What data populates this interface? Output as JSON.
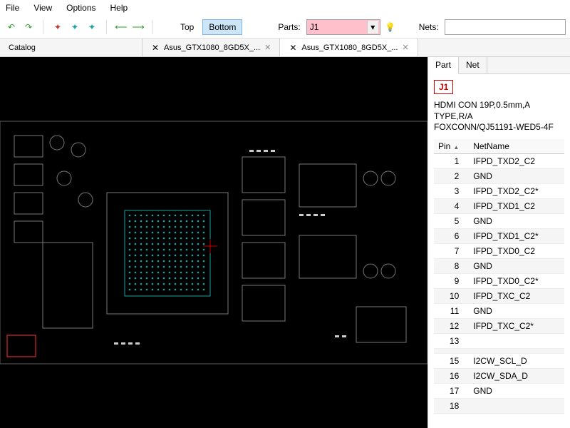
{
  "menu": {
    "file": "File",
    "view": "View",
    "options": "Options",
    "help": "Help"
  },
  "toolbar": {
    "top_label": "Top",
    "bottom_label": "Bottom",
    "parts_label": "Parts:",
    "nets_label": "Nets:",
    "parts_value": "J1",
    "nets_value": ""
  },
  "tabs": {
    "catalog": "Catalog",
    "items": [
      {
        "label": "Asus_GTX1080_8GD5X_..."
      },
      {
        "label": "Asus_GTX1080_8GD5X_..."
      }
    ]
  },
  "side": {
    "tab_part": "Part",
    "tab_net": "Net",
    "part_name": "J1",
    "desc_line1": "HDMI CON 19P,0.5mm,A TYPE,R/A",
    "desc_line2": "FOXCONN/QJ51191-WED5-4F",
    "col_pin": "Pin",
    "col_net": "NetName",
    "pins": [
      {
        "pin": "1",
        "net": "IFPD_TXD2_C2"
      },
      {
        "pin": "2",
        "net": "GND"
      },
      {
        "pin": "3",
        "net": "IFPD_TXD2_C2*"
      },
      {
        "pin": "4",
        "net": "IFPD_TXD1_C2"
      },
      {
        "pin": "5",
        "net": "GND"
      },
      {
        "pin": "6",
        "net": "IFPD_TXD1_C2*"
      },
      {
        "pin": "7",
        "net": "IFPD_TXD0_C2"
      },
      {
        "pin": "8",
        "net": "GND"
      },
      {
        "pin": "9",
        "net": "IFPD_TXD0_C2*"
      },
      {
        "pin": "10",
        "net": "IFPD_TXC_C2"
      },
      {
        "pin": "11",
        "net": "GND"
      },
      {
        "pin": "12",
        "net": "IFPD_TXC_C2*"
      },
      {
        "pin": "13",
        "net": ""
      },
      {
        "pin": "",
        "net": ""
      },
      {
        "pin": "15",
        "net": "I2CW_SCL_D"
      },
      {
        "pin": "16",
        "net": "I2CW_SDA_D"
      },
      {
        "pin": "17",
        "net": "GND"
      },
      {
        "pin": "18",
        "net": ""
      }
    ]
  }
}
